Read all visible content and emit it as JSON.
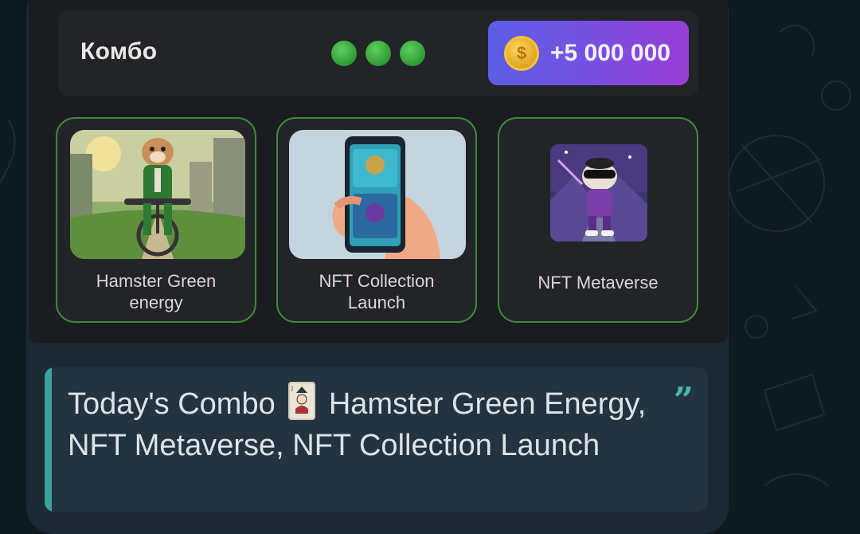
{
  "combo": {
    "title": "Комбо",
    "progress_dots": 3,
    "reward_icon": "coin-icon",
    "reward": "+5 000 000"
  },
  "cards": [
    {
      "label": "Hamster Green energy",
      "image": "hamster-cyclist"
    },
    {
      "label": "NFT Collection Launch",
      "image": "phone-nft"
    },
    {
      "label": "NFT Metaverse",
      "image": "hamster-metaverse"
    }
  ],
  "message": {
    "text_before": "Today's Combo",
    "emoji": "joker-card-icon",
    "text_after": "Hamster Green Energy, NFT Metaverse, NFT Collection Launch",
    "accent": "#3aa39a"
  },
  "colors": {
    "green": "#3c8a3c",
    "purple": "#7a4fe0",
    "gold": "#f5c23d"
  }
}
